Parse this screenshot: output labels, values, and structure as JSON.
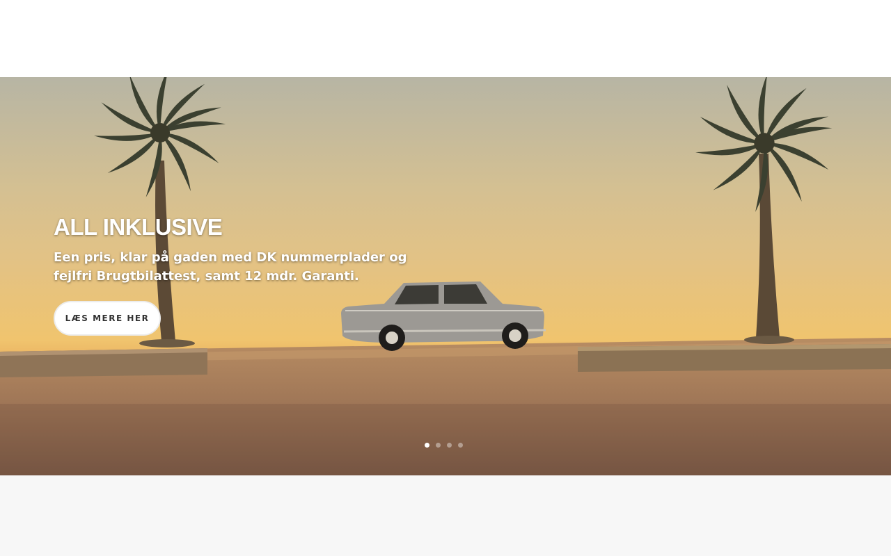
{
  "slider": {
    "title": "ALL INKLUSIVE",
    "text": "Een pris, klar på gaden med DK nummerplader og fejlfri Brugtbilattest, samt 12 mdr. Garanti.",
    "button_label": "LÆS MERE HER",
    "active_slide": 1,
    "slide_count": 4
  },
  "colors": {
    "header_bg": "#ffffff",
    "page_bg": "#f7f7f7",
    "button_bg": "#ffffff",
    "button_text": "#333333"
  }
}
